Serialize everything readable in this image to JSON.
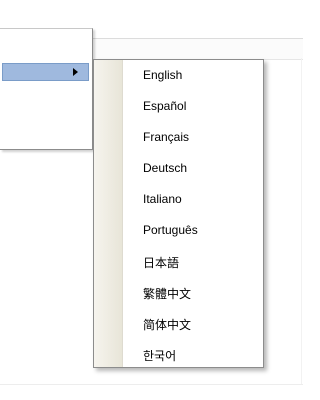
{
  "languages": [
    "English",
    "Español",
    "Français",
    "Deutsch",
    "Italiano",
    "Português",
    "日本語",
    "繁體中文",
    "简体中文",
    "한국어"
  ]
}
